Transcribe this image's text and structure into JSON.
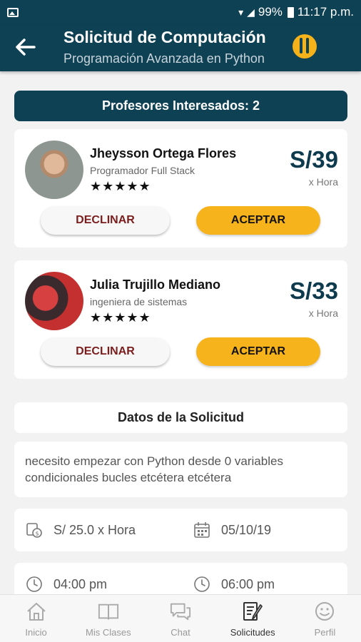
{
  "status_bar": {
    "battery": "99%",
    "time": "11:17 p.m."
  },
  "header": {
    "title": "Solicitud de Computación",
    "subtitle": "Programación Avanzada en Python"
  },
  "interested_banner": "Profesores Interesados: 2",
  "teachers": [
    {
      "name": "Jheysson Ortega Flores",
      "role": "Programador Full Stack",
      "rating": 4.5,
      "stars": "★★★★★",
      "price": "S/39",
      "unit": "x Hora",
      "decline_label": "DECLINAR",
      "accept_label": "ACEPTAR"
    },
    {
      "name": "Julia Trujillo Mediano",
      "role": "ingeniera de sistemas",
      "rating": 5,
      "stars": "★★★★★",
      "price": "S/33",
      "unit": "x Hora",
      "decline_label": "DECLINAR",
      "accept_label": "ACEPTAR"
    }
  ],
  "request": {
    "section_title": "Datos de la Solicitud",
    "description": "necesito empezar con Python desde 0 variables condicionales bucles etcétera etcétera",
    "price": "S/ 25.0 x Hora",
    "date": "05/10/19",
    "start_time": "04:00 pm",
    "end_time": "06:00 pm"
  },
  "bottom_nav": [
    {
      "label": "Inicio",
      "icon": "home-icon",
      "active": false
    },
    {
      "label": "Mis Clases",
      "icon": "book-icon",
      "active": false
    },
    {
      "label": "Chat",
      "icon": "chat-icon",
      "active": false
    },
    {
      "label": "Solicitudes",
      "icon": "requests-icon",
      "active": true
    },
    {
      "label": "Perfil",
      "icon": "smiley-icon",
      "active": false
    }
  ],
  "colors": {
    "primary": "#0e4154",
    "accent": "#f6b31b",
    "decline_text": "#7c1d1d"
  }
}
